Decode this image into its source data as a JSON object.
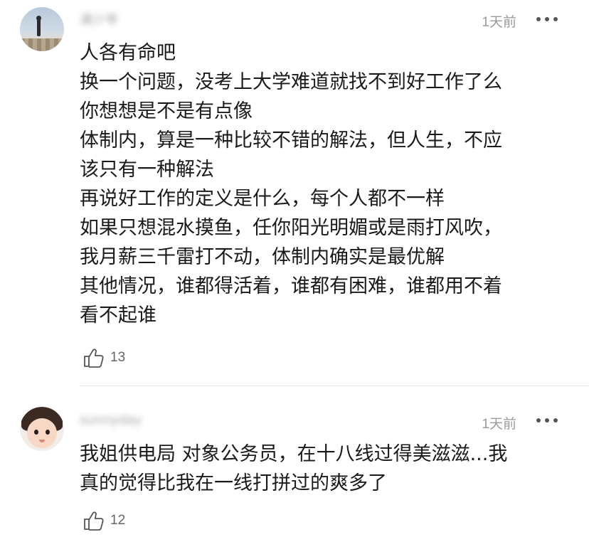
{
  "comments": [
    {
      "username": "满少爷",
      "time": "1天前",
      "lines": [
        "人各有命吧",
        "换一个问题，没考上大学难道就找不到好工作了么",
        "你想想是不是有点像",
        "体制内，算是一种比较不错的解法，但人生，不应",
        "该只有一种解法",
        "再说好工作的定义是什么，每个人都不一样",
        "如果只想混水摸鱼，任你阳光明媚或是雨打风吹，",
        "我月薪三千雷打不动，体制内确实是最优解",
        "其他情况，谁都得活着，谁都有困难，谁都用不着",
        "看不起谁"
      ],
      "likes": "13"
    },
    {
      "username": "sunnyday",
      "time": "1天前",
      "lines": [
        "我姐供电局 对象公务员，在十八线过得美滋滋...我",
        "真的觉得比我在一线打拼过的爽多了"
      ],
      "likes": "12"
    }
  ]
}
